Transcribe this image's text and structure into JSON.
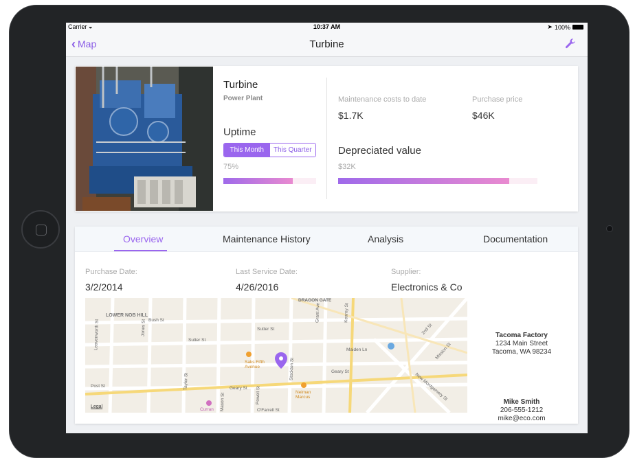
{
  "status_bar": {
    "carrier": "Carrier",
    "time": "10:37 AM",
    "battery": "100%"
  },
  "nav": {
    "back_label": "Map",
    "title": "Turbine",
    "settings_icon": "wrench-icon"
  },
  "equipment": {
    "name": "Turbine",
    "location": "Power Plant",
    "uptime_label": "Uptime",
    "uptime_options": [
      "This Month",
      "This Quarter"
    ],
    "uptime_selected": "This Month",
    "uptime_value": "75%",
    "uptime_fraction": 0.75
  },
  "stats": {
    "maintenance_label": "Maintenance costs to date",
    "maintenance_value": "$1.7K",
    "purchase_label": "Purchase price",
    "purchase_value": "$46K",
    "depreciated_label": "Depreciated value",
    "depreciated_value": "$32K",
    "depreciated_fraction": 0.86
  },
  "tabs": [
    {
      "label": "Overview",
      "active": true
    },
    {
      "label": "Maintenance History",
      "active": false
    },
    {
      "label": "Analysis",
      "active": false
    },
    {
      "label": "Documentation",
      "active": false
    }
  ],
  "details": {
    "purchase_date_label": "Purchase Date:",
    "purchase_date": "3/2/2014",
    "last_service_label": "Last Service Date:",
    "last_service": "4/26/2016",
    "supplier_label": "Supplier:",
    "supplier": "Electronics & Co"
  },
  "map": {
    "legal": "Legal",
    "labels": {
      "lower_nob_hill": "LOWER NOB HILL",
      "bush_st": "Bush St",
      "sutter_st": "Sutter St",
      "post_st": "Post St",
      "geary_st": "Geary St",
      "ofarrell_st": "O'Farrell St",
      "dragon_gate": "DRAGON GATE",
      "maiden_ln": "Maiden Ln",
      "saks": "Saks Fifth Avenue",
      "neiman": "Neiman Marcus",
      "curran": "Curran",
      "mission_st": "Mission St",
      "new_montgomery": "New Montgomery St",
      "second_st": "2nd St",
      "jones_st": "Jones St",
      "taylor_st": "Taylor St",
      "mason_st": "Mason St",
      "powell_st": "Powell St",
      "stockton_st": "Stockton St",
      "grant_ave": "Grant Ave",
      "kearny_st": "Kearny St",
      "leavenworth_st": "Leavenworth St"
    }
  },
  "contacts": {
    "factory_name": "Tacoma Factory",
    "factory_street": "1234 Main Street",
    "factory_city": "Tacoma, WA 98234",
    "person_name": "Mike Smith",
    "person_phone": "206-555-1212",
    "person_email": "mike@eco.com"
  },
  "colors": {
    "accent": "#9a66ee",
    "bar_end": "#e98ad0",
    "bar_track": "#fbeef5"
  }
}
